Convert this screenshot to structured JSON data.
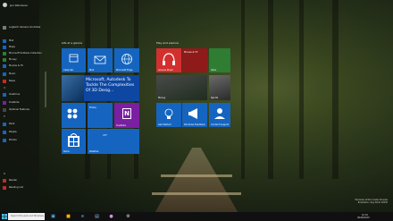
{
  "user": {
    "name": "Jan Wanderer"
  },
  "apps": [
    {
      "label": "Logitech Camera Controller",
      "color": "#7a7a7a"
    },
    {
      "label": "Mail",
      "color": "#1565c0"
    },
    {
      "label": "Maps",
      "color": "#1565c0"
    },
    {
      "label": "Microsoft Solitaire Collection",
      "color": "#2e7d32"
    },
    {
      "label": "Money",
      "color": "#2e7d32"
    },
    {
      "label": "Movies & TV",
      "color": "#1565c0"
    },
    {
      "label": "Music",
      "color": "#1565c0"
    },
    {
      "label": "News",
      "color": "#c62828"
    },
    {
      "label": "OneDrive",
      "color": "#1565c0"
    },
    {
      "label": "OneNote",
      "color": "#7b1fa2"
    },
    {
      "label": "Optional Features",
      "color": "#444444"
    },
    {
      "label": "Paint",
      "color": "#1565c0"
    },
    {
      "label": "People",
      "color": "#1565c0"
    },
    {
      "label": "Photos",
      "color": "#1565c0"
    },
    {
      "label": "Reader",
      "color": "#c62828"
    },
    {
      "label": "Reading List",
      "color": "#c62828"
    }
  ],
  "letters": [
    "O",
    "P",
    "R"
  ],
  "groups": {
    "life": "Life at a glance",
    "play": "Play and explore"
  },
  "tiles": {
    "calendar": "Calendar",
    "mail": "Mail",
    "edge": "Microsoft Edge",
    "photos": "Photos",
    "news_headline": "Microsoft, Autodesk To Tackle The Complexities Of 3D Desig...",
    "onenote": "OneNote",
    "store": "Store",
    "weather_label": "Weather",
    "weather_temp": "15°",
    "groove": "Groove Music",
    "movies": "Movies & TV",
    "xbox": "Xbox",
    "money": "Money",
    "sports": "Sports",
    "getstarted": "Get Started",
    "feedback": "Windows Feedback",
    "contact": "Contact Support"
  },
  "taskbar": {
    "search_placeholder": "Search the web and Windows",
    "time": "10:32",
    "date": "09/08/2015"
  },
  "watermark": [
    "Windows 10 Pro Insider Preview",
    "Evaluation copy. Build 10532"
  ],
  "colors": {
    "accent": "#1565c0",
    "onenote": "#7b1fa2",
    "groove": "#d32f2f",
    "xbox": "#2e7d32",
    "taskbar": "#101010"
  }
}
